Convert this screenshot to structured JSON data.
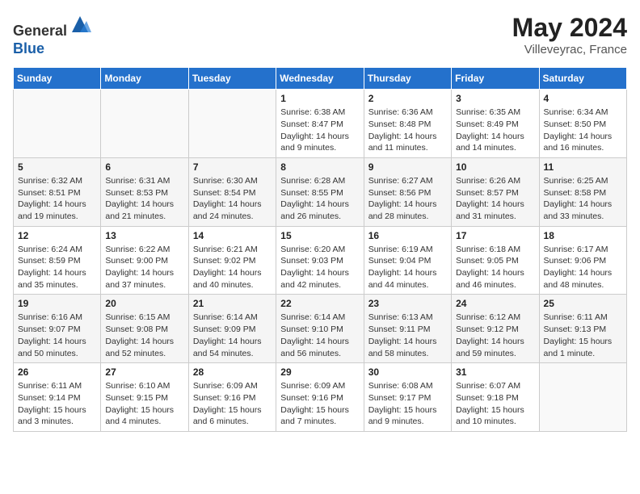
{
  "header": {
    "logo_line1": "General",
    "logo_line2": "Blue",
    "month_year": "May 2024",
    "location": "Villeveyrac, France"
  },
  "days_of_week": [
    "Sunday",
    "Monday",
    "Tuesday",
    "Wednesday",
    "Thursday",
    "Friday",
    "Saturday"
  ],
  "weeks": [
    [
      {
        "day": "",
        "info": ""
      },
      {
        "day": "",
        "info": ""
      },
      {
        "day": "",
        "info": ""
      },
      {
        "day": "1",
        "info": "Sunrise: 6:38 AM\nSunset: 8:47 PM\nDaylight: 14 hours\nand 9 minutes."
      },
      {
        "day": "2",
        "info": "Sunrise: 6:36 AM\nSunset: 8:48 PM\nDaylight: 14 hours\nand 11 minutes."
      },
      {
        "day": "3",
        "info": "Sunrise: 6:35 AM\nSunset: 8:49 PM\nDaylight: 14 hours\nand 14 minutes."
      },
      {
        "day": "4",
        "info": "Sunrise: 6:34 AM\nSunset: 8:50 PM\nDaylight: 14 hours\nand 16 minutes."
      }
    ],
    [
      {
        "day": "5",
        "info": "Sunrise: 6:32 AM\nSunset: 8:51 PM\nDaylight: 14 hours\nand 19 minutes."
      },
      {
        "day": "6",
        "info": "Sunrise: 6:31 AM\nSunset: 8:53 PM\nDaylight: 14 hours\nand 21 minutes."
      },
      {
        "day": "7",
        "info": "Sunrise: 6:30 AM\nSunset: 8:54 PM\nDaylight: 14 hours\nand 24 minutes."
      },
      {
        "day": "8",
        "info": "Sunrise: 6:28 AM\nSunset: 8:55 PM\nDaylight: 14 hours\nand 26 minutes."
      },
      {
        "day": "9",
        "info": "Sunrise: 6:27 AM\nSunset: 8:56 PM\nDaylight: 14 hours\nand 28 minutes."
      },
      {
        "day": "10",
        "info": "Sunrise: 6:26 AM\nSunset: 8:57 PM\nDaylight: 14 hours\nand 31 minutes."
      },
      {
        "day": "11",
        "info": "Sunrise: 6:25 AM\nSunset: 8:58 PM\nDaylight: 14 hours\nand 33 minutes."
      }
    ],
    [
      {
        "day": "12",
        "info": "Sunrise: 6:24 AM\nSunset: 8:59 PM\nDaylight: 14 hours\nand 35 minutes."
      },
      {
        "day": "13",
        "info": "Sunrise: 6:22 AM\nSunset: 9:00 PM\nDaylight: 14 hours\nand 37 minutes."
      },
      {
        "day": "14",
        "info": "Sunrise: 6:21 AM\nSunset: 9:02 PM\nDaylight: 14 hours\nand 40 minutes."
      },
      {
        "day": "15",
        "info": "Sunrise: 6:20 AM\nSunset: 9:03 PM\nDaylight: 14 hours\nand 42 minutes."
      },
      {
        "day": "16",
        "info": "Sunrise: 6:19 AM\nSunset: 9:04 PM\nDaylight: 14 hours\nand 44 minutes."
      },
      {
        "day": "17",
        "info": "Sunrise: 6:18 AM\nSunset: 9:05 PM\nDaylight: 14 hours\nand 46 minutes."
      },
      {
        "day": "18",
        "info": "Sunrise: 6:17 AM\nSunset: 9:06 PM\nDaylight: 14 hours\nand 48 minutes."
      }
    ],
    [
      {
        "day": "19",
        "info": "Sunrise: 6:16 AM\nSunset: 9:07 PM\nDaylight: 14 hours\nand 50 minutes."
      },
      {
        "day": "20",
        "info": "Sunrise: 6:15 AM\nSunset: 9:08 PM\nDaylight: 14 hours\nand 52 minutes."
      },
      {
        "day": "21",
        "info": "Sunrise: 6:14 AM\nSunset: 9:09 PM\nDaylight: 14 hours\nand 54 minutes."
      },
      {
        "day": "22",
        "info": "Sunrise: 6:14 AM\nSunset: 9:10 PM\nDaylight: 14 hours\nand 56 minutes."
      },
      {
        "day": "23",
        "info": "Sunrise: 6:13 AM\nSunset: 9:11 PM\nDaylight: 14 hours\nand 58 minutes."
      },
      {
        "day": "24",
        "info": "Sunrise: 6:12 AM\nSunset: 9:12 PM\nDaylight: 14 hours\nand 59 minutes."
      },
      {
        "day": "25",
        "info": "Sunrise: 6:11 AM\nSunset: 9:13 PM\nDaylight: 15 hours\nand 1 minute."
      }
    ],
    [
      {
        "day": "26",
        "info": "Sunrise: 6:11 AM\nSunset: 9:14 PM\nDaylight: 15 hours\nand 3 minutes."
      },
      {
        "day": "27",
        "info": "Sunrise: 6:10 AM\nSunset: 9:15 PM\nDaylight: 15 hours\nand 4 minutes."
      },
      {
        "day": "28",
        "info": "Sunrise: 6:09 AM\nSunset: 9:16 PM\nDaylight: 15 hours\nand 6 minutes."
      },
      {
        "day": "29",
        "info": "Sunrise: 6:09 AM\nSunset: 9:16 PM\nDaylight: 15 hours\nand 7 minutes."
      },
      {
        "day": "30",
        "info": "Sunrise: 6:08 AM\nSunset: 9:17 PM\nDaylight: 15 hours\nand 9 minutes."
      },
      {
        "day": "31",
        "info": "Sunrise: 6:07 AM\nSunset: 9:18 PM\nDaylight: 15 hours\nand 10 minutes."
      },
      {
        "day": "",
        "info": ""
      }
    ]
  ]
}
